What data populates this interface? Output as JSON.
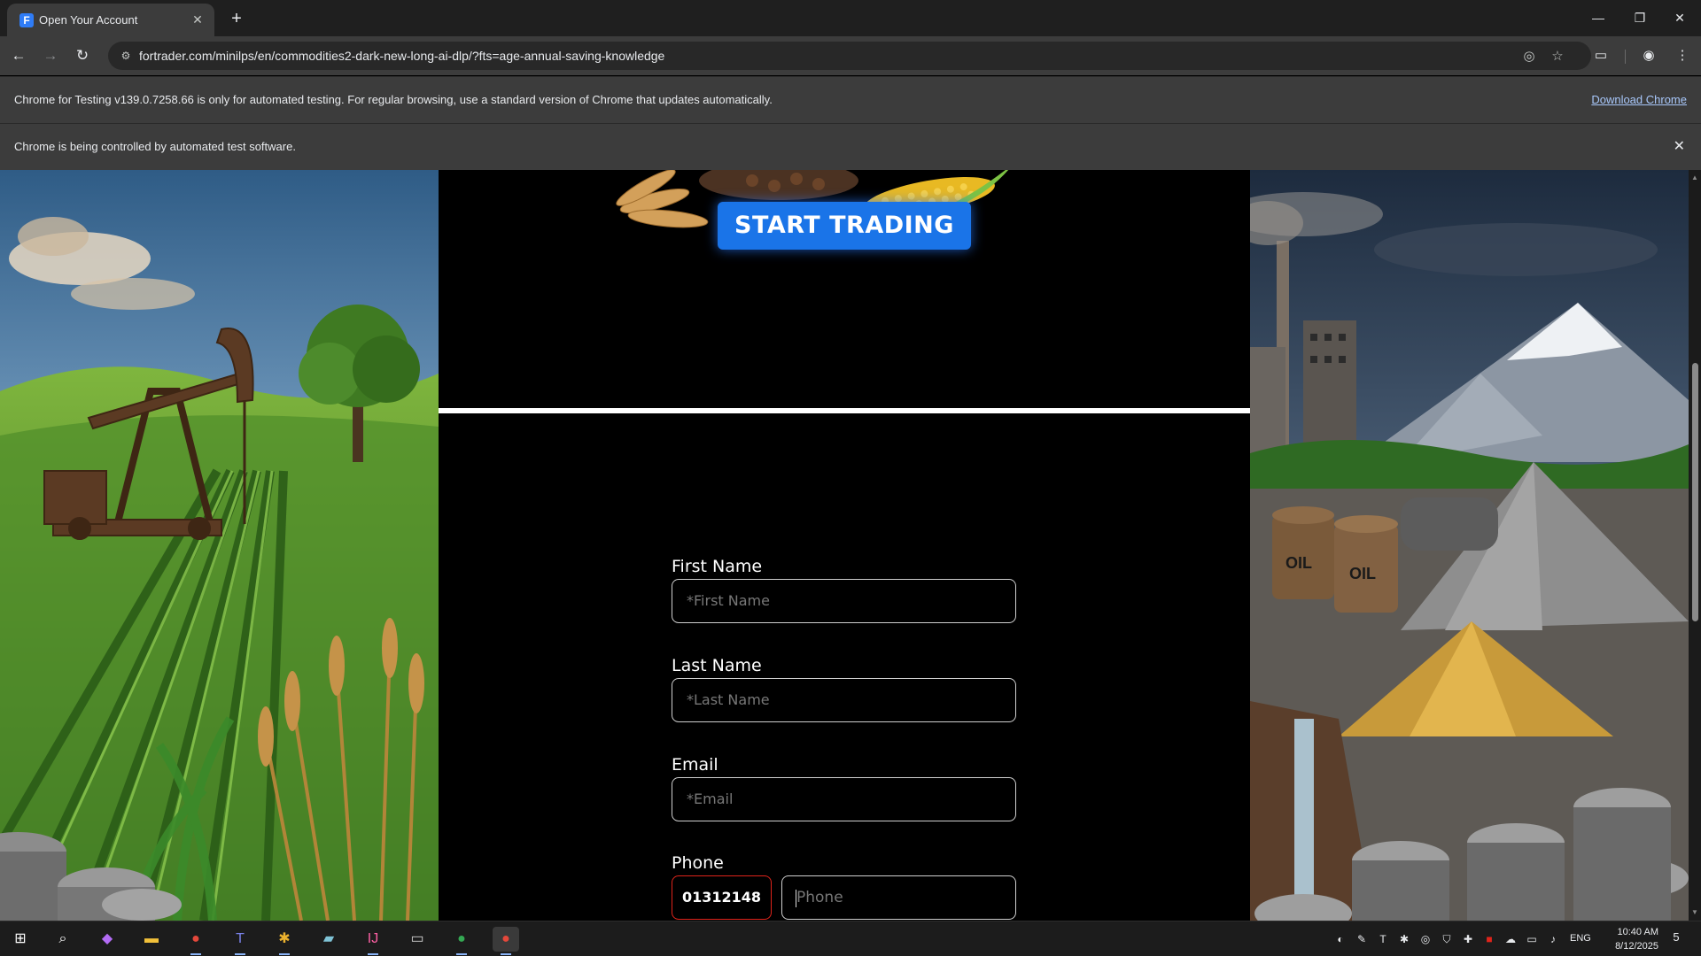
{
  "browser": {
    "tab_title": "Open Your Account",
    "tab_favicon_letter": "F",
    "url": "fortrader.com/minilps/en/commodities2-dark-new-long-ai-dlp/?fts=age-annual-saving-knowledge",
    "infobar_testing_text": "Chrome for Testing v139.0.7258.66 is only for automated testing. For regular browsing, use a standard version of Chrome that updates automatically.",
    "infobar_download_link": "Download Chrome",
    "infobar_automation_text": "Chrome is being controlled by automated test software."
  },
  "page": {
    "hero_button_label": "START TRADING",
    "form": {
      "first_name_label": "First Name",
      "first_name_placeholder": "*First Name",
      "last_name_label": "Last Name",
      "last_name_placeholder": "*Last Name",
      "email_label": "Email",
      "email_placeholder": "*Email",
      "phone_label": "Phone",
      "phone_code_value": "01312148",
      "phone_placeholder": "Phone"
    },
    "barrel_label": "OIL",
    "colors": {
      "accent": "#1a74e8",
      "error_border": "#e0241b"
    }
  },
  "taskbar": {
    "language": "ENG",
    "time": "10:40 AM",
    "date": "8/12/2025",
    "notification_count": "5",
    "apps": [
      "start-icon",
      "search-icon",
      "copilot-icon",
      "file-explorer-icon",
      "chrome-icon",
      "teams-icon",
      "slack-icon",
      "notes-icon",
      "intellij-icon",
      "terminal-icon",
      "chrome-icon",
      "chrome-testing-icon"
    ]
  }
}
